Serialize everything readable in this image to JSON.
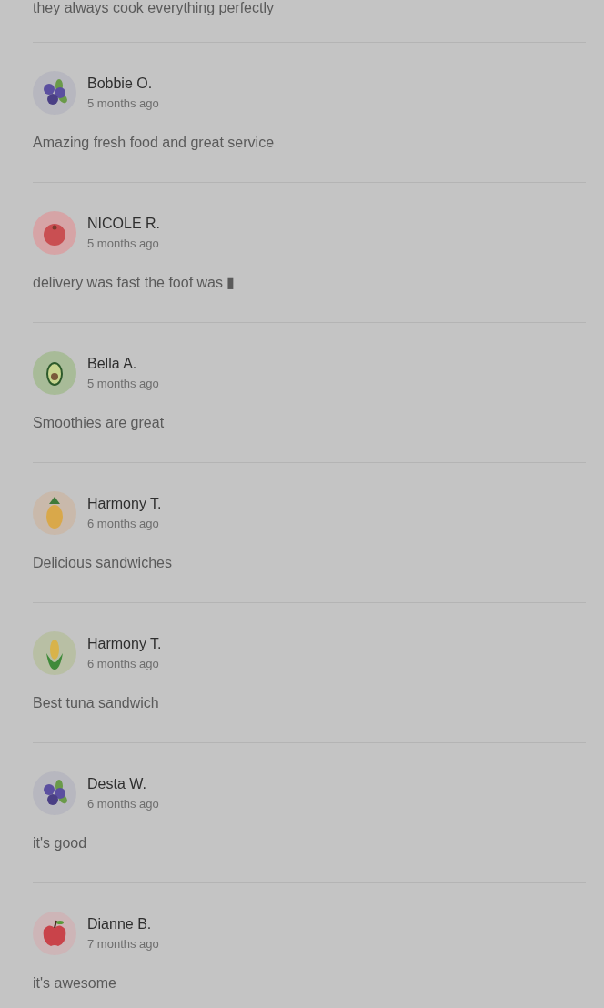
{
  "reviews": [
    {
      "text": "they always cook everything perfectly"
    },
    {
      "name": "Bobbie O.",
      "time": "5 months ago",
      "avatar": {
        "kind": "blueberries"
      },
      "text": "Amazing fresh food and great service"
    },
    {
      "name": "NICOLE R.",
      "time": "5 months ago",
      "avatar": {
        "kind": "tomato"
      },
      "text": "delivery was fast the foof was ▮"
    },
    {
      "name": "Bella A.",
      "time": "5 months ago",
      "avatar": {
        "kind": "avocado"
      },
      "text": "Smoothies are great"
    },
    {
      "name": "Harmony T.",
      "time": "6 months ago",
      "avatar": {
        "kind": "pineapple"
      },
      "text": "Delicious sandwiches"
    },
    {
      "name": "Harmony T.",
      "time": "6 months ago",
      "avatar": {
        "kind": "corn"
      },
      "text": "Best tuna sandwich"
    },
    {
      "name": "Desta W.",
      "time": "6 months ago",
      "avatar": {
        "kind": "blueberries"
      },
      "text": "it's good"
    },
    {
      "name": "Dianne B.",
      "time": "7 months ago",
      "avatar": {
        "kind": "apple"
      },
      "text": "it's awesome"
    }
  ]
}
